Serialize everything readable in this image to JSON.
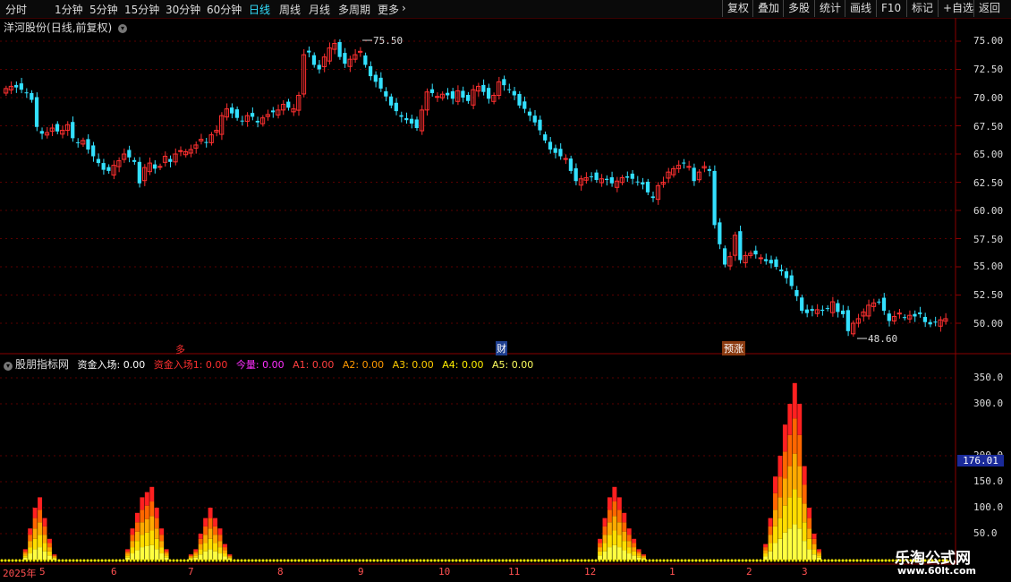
{
  "toolbar": {
    "periods": [
      "分时",
      "1分钟",
      "5分钟",
      "15分钟",
      "30分钟",
      "60分钟",
      "日线",
      "周线",
      "月线",
      "多周期",
      "更多"
    ],
    "active_period": "日线",
    "right_buttons": [
      "复权",
      "叠加",
      "多股",
      "统计",
      "画线",
      "F10",
      "标记",
      "+自选",
      "返回"
    ]
  },
  "title": {
    "stock": "洋河股份",
    "mode": "(日线,前复权)"
  },
  "price_axis": [
    "75.00",
    "72.50",
    "70.00",
    "67.50",
    "65.00",
    "62.50",
    "60.00",
    "57.50",
    "55.00",
    "52.50",
    "50.00"
  ],
  "annotations": {
    "high": "75.50",
    "low": "48.60",
    "marker_left": "多",
    "marker_mid": "财",
    "marker_right": "预涨"
  },
  "indicator": {
    "name": "股朋指标网",
    "items": [
      {
        "label": "资金入场: 0.00",
        "color": "#ffffff"
      },
      {
        "label": "资金入场1: 0.00",
        "color": "#ff3030"
      },
      {
        "label": "今量: 0.00",
        "color": "#ff30ff"
      },
      {
        "label": "A1: 0.00",
        "color": "#ff4040"
      },
      {
        "label": "A2: 0.00",
        "color": "#ff9900"
      },
      {
        "label": "A3: 0.00",
        "color": "#ffcc00"
      },
      {
        "label": "A4: 0.00",
        "color": "#ffee00"
      },
      {
        "label": "A5: 0.00",
        "color": "#ffff60"
      }
    ],
    "axis": [
      "350.0",
      "300.0",
      "200.0",
      "150.0",
      "100.0",
      "50.0"
    ],
    "current_value": "176.01"
  },
  "time_axis": [
    "2025年",
    "5",
    "6",
    "7",
    "8",
    "9",
    "10",
    "11",
    "12",
    "1",
    "2",
    "3"
  ],
  "watermark": {
    "name": "乐淘公式网",
    "url": "www.60lt.com"
  },
  "chart_data": {
    "type": "candlestick",
    "colors": {
      "up": "#ff3030",
      "down": "#33e0ff"
    },
    "closes": [
      70.8,
      71.0,
      70.9,
      70.7,
      70.4,
      69.8,
      67.4,
      66.8,
      66.9,
      67.3,
      67.0,
      67.1,
      67.6,
      66.4,
      66.0,
      66.2,
      65.4,
      64.8,
      64.2,
      63.6,
      63.5,
      64.0,
      64.4,
      65.0,
      64.7,
      64.3,
      62.4,
      63.8,
      64.2,
      63.7,
      63.9,
      64.8,
      64.3,
      65.0,
      65.3,
      65.2,
      65.4,
      65.8,
      66.3,
      66.0,
      66.7,
      67.1,
      68.4,
      69.0,
      68.6,
      68.2,
      67.9,
      68.4,
      68.3,
      67.8,
      68.2,
      68.5,
      68.7,
      68.9,
      69.4,
      69.1,
      69.0,
      70.2,
      73.8,
      74.0,
      72.9,
      72.5,
      73.6,
      74.4,
      74.8,
      73.6,
      73.0,
      73.4,
      73.8,
      74.1,
      72.9,
      71.9,
      71.4,
      70.8,
      70.1,
      69.3,
      68.8,
      68.3,
      68.0,
      67.7,
      67.3,
      68.9,
      70.5,
      70.4,
      70.1,
      70.3,
      70.2,
      69.9,
      70.6,
      70.0,
      69.7,
      70.7,
      71.0,
      70.5,
      69.9,
      70.2,
      71.4,
      71.1,
      70.7,
      70.2,
      69.3,
      69.0,
      68.4,
      67.8,
      67.1,
      66.2,
      65.4,
      65.1,
      64.8,
      64.6,
      63.5,
      62.6,
      62.8,
      62.9,
      63.0,
      62.7,
      62.8,
      62.7,
      62.4,
      62.6,
      62.9,
      62.9,
      62.8,
      62.5,
      62.3,
      61.6,
      61.1,
      62.2,
      62.5,
      63.4,
      63.7,
      64.0,
      64.2,
      63.9,
      62.6,
      63.4,
      63.9,
      63.5,
      58.7,
      57.0,
      55.2,
      55.9,
      57.8,
      55.6,
      56.0,
      56.2,
      56.1,
      55.8,
      55.5,
      55.3,
      55.0,
      54.6,
      54.0,
      53.3,
      52.4,
      51.1,
      50.9,
      51.1,
      51.2,
      51.1,
      51.3,
      51.9,
      51.0,
      50.8,
      49.3,
      50.0,
      50.4,
      51.0,
      51.6,
      51.8,
      51.9,
      51.1,
      50.2,
      50.6,
      50.9,
      50.5,
      50.7,
      50.6,
      50.8,
      50.1,
      49.9,
      50.1,
      50.3,
      50.4
    ],
    "opens_offset": "close-1",
    "high": 75.5,
    "low": 48.6,
    "ylim": [
      48.6,
      75.5
    ],
    "indicator_volume": [
      0,
      0,
      0,
      0,
      2,
      6,
      10,
      12,
      8,
      4,
      1,
      0,
      0,
      0,
      0,
      0,
      0,
      0,
      0,
      0,
      0,
      0,
      0,
      0,
      0,
      2,
      6,
      9,
      12,
      13,
      14,
      10,
      6,
      2,
      0,
      0,
      0,
      0,
      1,
      2,
      5,
      8,
      10,
      8,
      6,
      3,
      1,
      0,
      0,
      0,
      0,
      0,
      0,
      0,
      0,
      0,
      0,
      0,
      0,
      0,
      0,
      0,
      0,
      0,
      0,
      0,
      0,
      0,
      0,
      0,
      0,
      0,
      0,
      0,
      0,
      0,
      0,
      0,
      0,
      0,
      0,
      0,
      0,
      0,
      0,
      0,
      0,
      0,
      0,
      0,
      0,
      0,
      0,
      0,
      0,
      0,
      0,
      0,
      0,
      0,
      0,
      0,
      0,
      0,
      0,
      0,
      0,
      0,
      0,
      0,
      0,
      0,
      0,
      0,
      0,
      0,
      0,
      0,
      0,
      0,
      0,
      0,
      4,
      8,
      12,
      14,
      12,
      9,
      6,
      4,
      2,
      1,
      0,
      0,
      0,
      0,
      0,
      0,
      0,
      0,
      0,
      0,
      0,
      0,
      0,
      0,
      0,
      0,
      0,
      0,
      0,
      0,
      0,
      0,
      0,
      0,
      3,
      8,
      16,
      20,
      26,
      30,
      34,
      30,
      18,
      10,
      5,
      2,
      0,
      0,
      0,
      0,
      0,
      0,
      0,
      0,
      0,
      0,
      0,
      0,
      0,
      0,
      0,
      0,
      0,
      0,
      0,
      0,
      0,
      0,
      0,
      0,
      0,
      0
    ]
  }
}
